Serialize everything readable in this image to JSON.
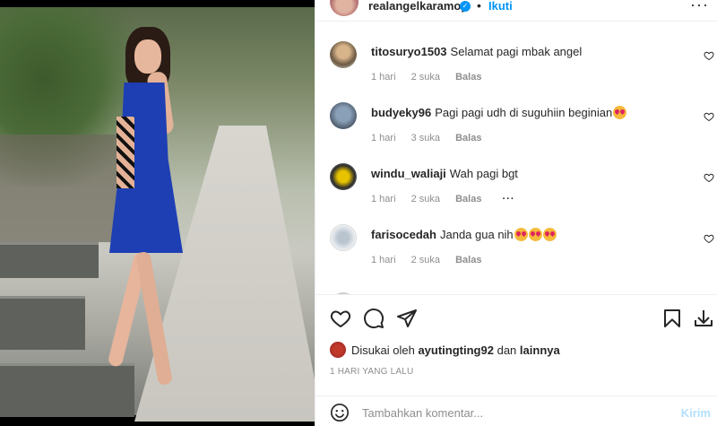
{
  "post": {
    "username": "realangelkaramoy",
    "verified_icon": "verified-badge-icon",
    "separator": "•",
    "follow_label": "Ikuti",
    "more_label": "···"
  },
  "comments": [
    {
      "user": "titosuryo1503",
      "text": "Selamat pagi mbak angel",
      "time": "1 hari",
      "likes": "2 suka",
      "reply": "Balas",
      "emoji_count": 0
    },
    {
      "user": "budyeky96",
      "text": "Pagi pagi udh di suguhiin beginian",
      "time": "1 hari",
      "likes": "3 suka",
      "reply": "Balas",
      "emoji_count": 1
    },
    {
      "user": "windu_waliaji",
      "text": "Wah pagi bgt",
      "time": "1 hari",
      "likes": "2 suka",
      "reply": "Balas",
      "options": "···",
      "emoji_count": 0
    },
    {
      "user": "farisocedah",
      "text": "Janda gua nih",
      "time": "1 hari",
      "likes": "2 suka",
      "reply": "Balas",
      "emoji_count": 3
    }
  ],
  "actions": {
    "icons": [
      "heart-icon",
      "comment-icon",
      "share-icon",
      "bookmark-icon",
      "download-icon"
    ]
  },
  "likes": {
    "prefix": "Disukai oleh",
    "user": "ayutingting92",
    "connector": "dan",
    "suffix": "lainnya"
  },
  "timestamp": "1 HARI YANG LALU",
  "add_comment": {
    "placeholder": "Tambahkan komentar...",
    "post_label": "Kirim"
  },
  "colors": {
    "accent": "#0095f6",
    "text": "#262626",
    "muted": "#8e8e8e",
    "post_disabled": "#b2dffc"
  }
}
